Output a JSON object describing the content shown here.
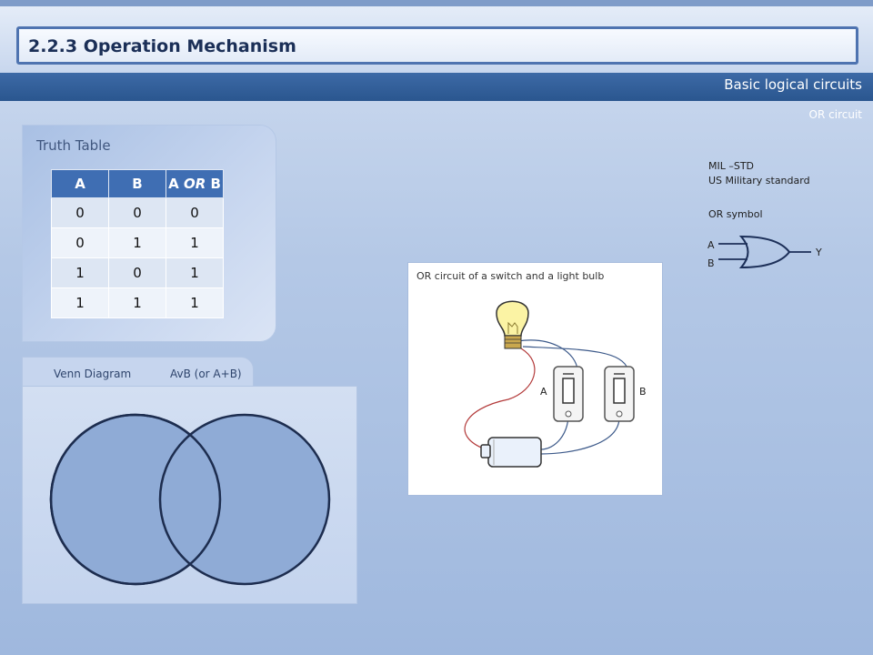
{
  "header": {
    "title": "2.2.3 Operation Mechanism",
    "section": "Basic logical circuits",
    "subsection": "OR circuit"
  },
  "truth_table": {
    "title": "Truth Table",
    "headers": [
      "A",
      "B",
      "A OR B"
    ],
    "rows": [
      [
        "0",
        "0",
        "0"
      ],
      [
        "0",
        "1",
        "1"
      ],
      [
        "1",
        "0",
        "1"
      ],
      [
        "1",
        "1",
        "1"
      ]
    ]
  },
  "venn": {
    "tab_label_1": "Venn Diagram",
    "tab_label_2": "AvB (or A+B)"
  },
  "circuit": {
    "caption": "OR circuit of a switch and a light bulb",
    "switch_a_label": "A",
    "switch_b_label": "B"
  },
  "standard": {
    "line1": "MIL –STD",
    "line2": "US Military standard",
    "symbol_title": "OR symbol",
    "input_a": "A",
    "input_b": "B",
    "output": "Y"
  },
  "colors": {
    "accent": "#3f6eb3",
    "bar": "#2a568f",
    "venn_fill": "#8fabd6",
    "venn_stroke": "#1d2d4f"
  }
}
